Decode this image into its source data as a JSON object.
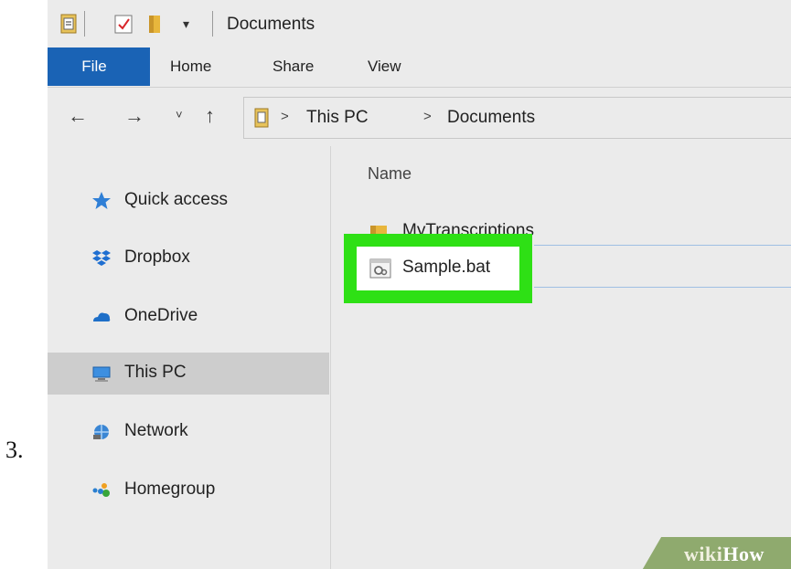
{
  "step": {
    "number": "3."
  },
  "window": {
    "title": "Documents"
  },
  "ribbon": {
    "tabs": [
      {
        "label": "File",
        "active": true
      },
      {
        "label": "Home"
      },
      {
        "label": "Share"
      },
      {
        "label": "View"
      }
    ]
  },
  "nav": {
    "back": "←",
    "forward": "→",
    "recent": "˅",
    "up": "↑",
    "separator": ">",
    "breadcrumb": [
      "This PC",
      "Documents"
    ]
  },
  "sidebar": {
    "items": [
      {
        "label": "Quick access",
        "icon": "star-icon"
      },
      {
        "label": "Dropbox",
        "icon": "dropbox-icon"
      },
      {
        "label": "OneDrive",
        "icon": "onedrive-icon"
      },
      {
        "label": "This PC",
        "icon": "computer-icon",
        "selected": true
      },
      {
        "label": "Network",
        "icon": "network-icon"
      },
      {
        "label": "Homegroup",
        "icon": "homegroup-icon"
      }
    ]
  },
  "files": {
    "column_name": "Name",
    "items": [
      {
        "label": "MyTranscriptions",
        "icon": "folder-icon"
      },
      {
        "label": "Sample.bat",
        "icon": "batch-file-icon",
        "highlighted": true
      }
    ]
  },
  "watermark": {
    "wiki": "wiki",
    "how": "How"
  },
  "colors": {
    "file_tab": "#1a63b5",
    "highlight": "#2ee015",
    "selected": "#cdcdcd"
  }
}
